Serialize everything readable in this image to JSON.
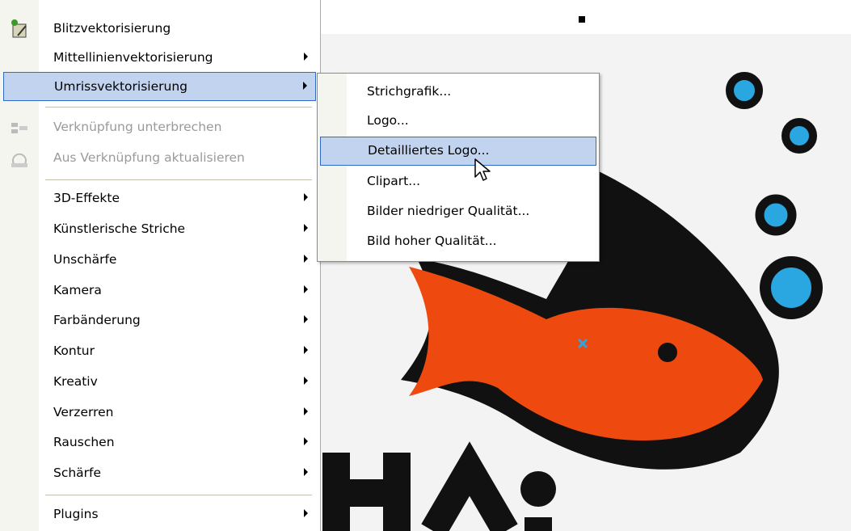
{
  "main_menu": {
    "items": [
      {
        "label": "Blitzvektorisierung",
        "submenu": false,
        "enabled": true,
        "icon": "trace-tool-icon"
      },
      {
        "label": "Mittellinienvektorisierung",
        "submenu": true,
        "enabled": true
      },
      {
        "label": "Umrissvektorisierung",
        "submenu": true,
        "enabled": true,
        "highlighted": true
      },
      {
        "label": "Verknüpfung unterbrechen",
        "submenu": false,
        "enabled": false,
        "icon": "break-link-icon"
      },
      {
        "label": "Aus Verknüpfung aktualisieren",
        "submenu": false,
        "enabled": false,
        "icon": "update-link-icon"
      },
      {
        "label": "3D-Effekte",
        "submenu": true,
        "enabled": true
      },
      {
        "label": "Künstlerische Striche",
        "submenu": true,
        "enabled": true
      },
      {
        "label": "Unschärfe",
        "submenu": true,
        "enabled": true
      },
      {
        "label": "Kamera",
        "submenu": true,
        "enabled": true
      },
      {
        "label": "Farbänderung",
        "submenu": true,
        "enabled": true
      },
      {
        "label": "Kontur",
        "submenu": true,
        "enabled": true
      },
      {
        "label": "Kreativ",
        "submenu": true,
        "enabled": true
      },
      {
        "label": "Verzerren",
        "submenu": true,
        "enabled": true
      },
      {
        "label": "Rauschen",
        "submenu": true,
        "enabled": true
      },
      {
        "label": "Schärfe",
        "submenu": true,
        "enabled": true
      },
      {
        "label": "Plugins",
        "submenu": true,
        "enabled": true
      }
    ]
  },
  "sub_menu": {
    "items": [
      {
        "label": "Strichgrafik..."
      },
      {
        "label": "Logo..."
      },
      {
        "label": "Detailliertes Logo...",
        "highlighted": true
      },
      {
        "label": "Clipart..."
      },
      {
        "label": "Bilder niedriger Qualität..."
      },
      {
        "label": "Bild hoher Qualität..."
      }
    ]
  },
  "canvas": {
    "image_text": "Hai",
    "colors": {
      "fish": "#ee4a10",
      "fin": "#f08a1a",
      "bubble": "#2aa6e0",
      "outline": "#111111"
    }
  }
}
